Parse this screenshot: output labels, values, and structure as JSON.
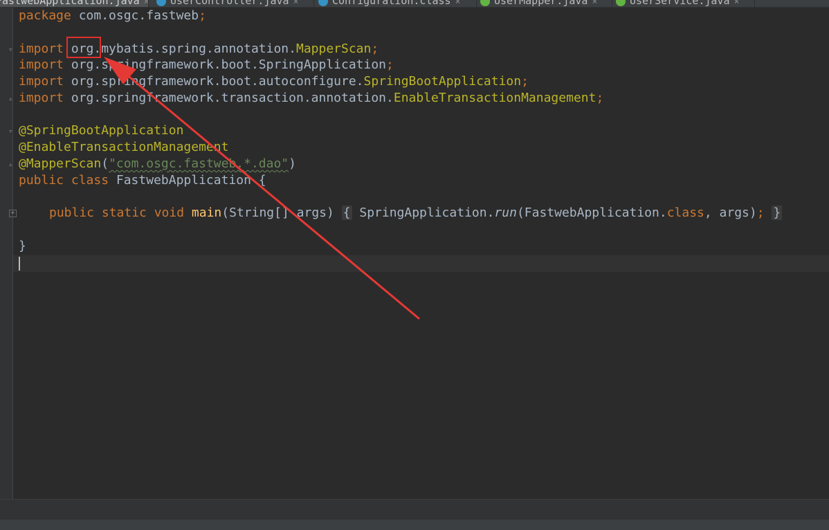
{
  "tabs": [
    {
      "label": "FastwebApplication.java",
      "icon_color": "#3592c4",
      "active": true
    },
    {
      "label": "UserController.java",
      "icon_color": "#3592c4"
    },
    {
      "label": "Configuration.class",
      "icon_color": "#3592c4"
    },
    {
      "label": "UserMapper.java",
      "icon_color": "#62b543"
    },
    {
      "label": "UserService.java",
      "icon_color": "#62b543"
    }
  ],
  "tab_close_glyph": "×",
  "code": {
    "package_kw": "package",
    "package_name": " com.osgc.fastweb",
    "semicolon": ";",
    "import_kw": "import",
    "import1_pkg": " org.mybatis.spring.annotation.",
    "import1_cls": "MapperScan",
    "import2_pkg": " org.springframework.boot.SpringApplication",
    "import3_pkg": " org.springframework.boot.autoconfigure.",
    "import3_cls": "SpringBootApplication",
    "import4_pkg": " org.springframework.transaction.annotation.",
    "import4_cls": "EnableTransactionManagement",
    "ann1": "@SpringBootApplication",
    "ann2": "@EnableTransactionManagement",
    "ann3": "@MapperScan",
    "ann3_open": "(",
    "ann3_str": "\"com.osgc.fastweb.*.dao\"",
    "ann3_close": ")",
    "class_kw": "public class",
    "class_name": " FastwebApplication ",
    "open_brace": "{",
    "method_kw": "public static void",
    "method_name": "main",
    "method_params": "(String[] args) ",
    "method_body_cls": " SpringApplication.",
    "method_body_run": "run",
    "method_body_args_1": "(FastwebApplication.",
    "method_body_class_kw": "class",
    "method_body_args_2": ", args)",
    "close_brace": "}"
  },
  "annotation": {
    "highlight_color": "#e0302c"
  }
}
